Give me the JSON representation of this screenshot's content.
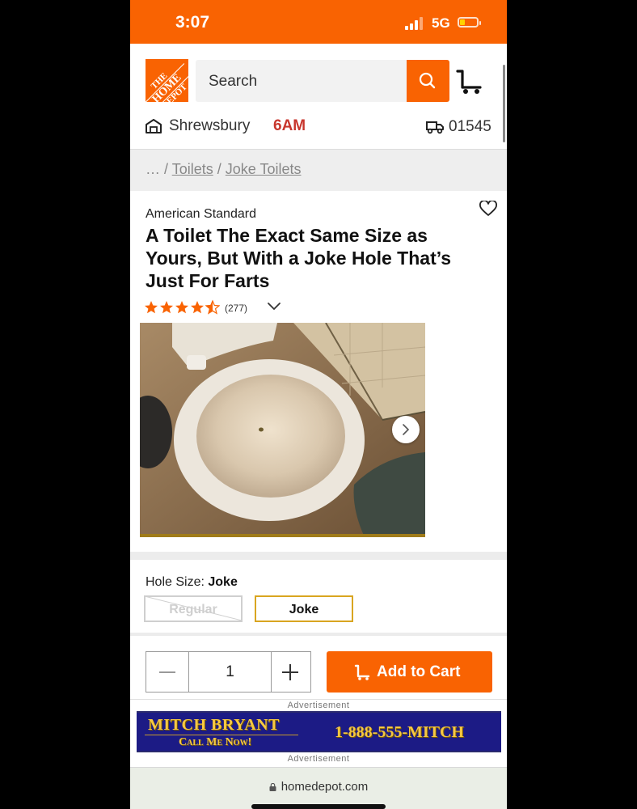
{
  "status_bar": {
    "time": "3:07",
    "network": "5G"
  },
  "header": {
    "logo_lines": [
      "THE",
      "HOME",
      "DEPOT"
    ],
    "search_placeholder": "Search",
    "store_name": "Shrewsbury",
    "store_hours": "6AM",
    "zip": "01545"
  },
  "breadcrumb": {
    "ellipsis": "… /",
    "items": [
      "Toilets",
      "Joke Toilets"
    ],
    "separator": "/"
  },
  "product": {
    "brand": "American Standard",
    "title": "A Toilet The Exact Same Size as Yours, But With a Joke Hole That’s Just For Farts",
    "rating_stars": 4.5,
    "review_count": "(277)"
  },
  "options": {
    "label": "Hole Size:",
    "selected": "Joke",
    "choices": [
      "Regular",
      "Joke"
    ]
  },
  "purchase": {
    "quantity": "1",
    "add_to_cart_label": "Add to Cart"
  },
  "ad": {
    "label_top": "Advertisement",
    "name": "MITCH BRYANT",
    "tagline": "Call Me Now!",
    "phone": "1-888-555-MITCH",
    "label_bottom": "Advertisement"
  },
  "browser": {
    "url": "homedepot.com"
  },
  "colors": {
    "brand_orange": "#f96302",
    "store_hours": "#c8362d",
    "option_selected": "#d9a520",
    "ad_bg": "#1c1b85",
    "ad_text": "#f5c842"
  }
}
